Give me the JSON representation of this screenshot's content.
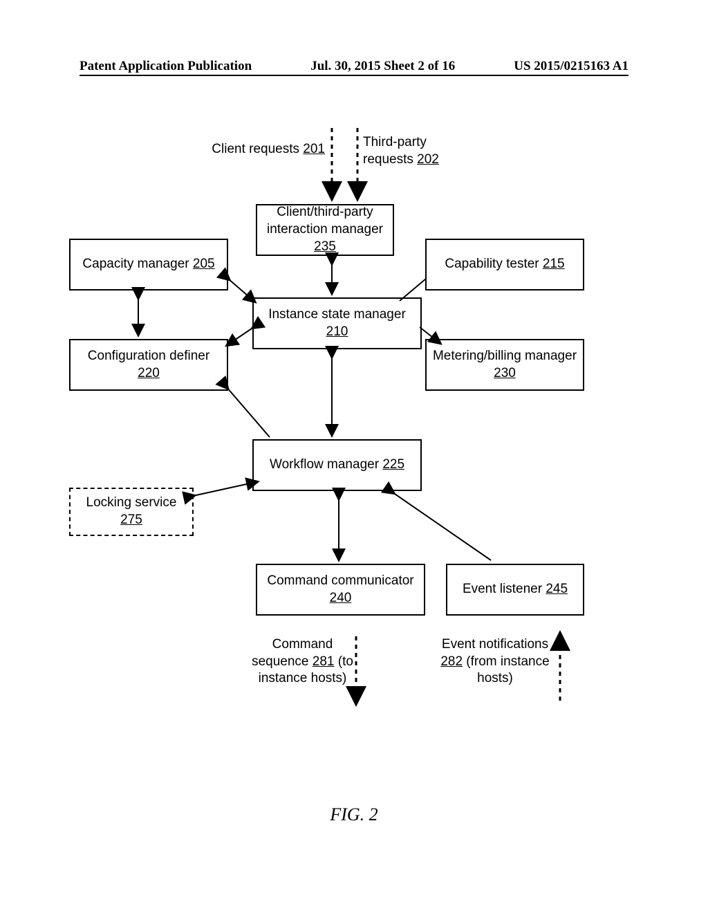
{
  "header": {
    "left": "Patent Application Publication",
    "center": "Jul. 30, 2015  Sheet 2 of 16",
    "right": "US 2015/0215163 A1"
  },
  "figure_label": "FIG. 2",
  "labels": {
    "client_requests": {
      "text": "Client requests ",
      "ref": "201"
    },
    "third_party_requests": {
      "text": "Third-party requests ",
      "ref": "202"
    },
    "command_sequence_a": "Command",
    "command_sequence_b": "sequence ",
    "command_sequence_ref": "281",
    "command_sequence_c": " (to instance hosts)",
    "event_notifications_a": "Event notifications ",
    "event_notifications_ref": "282",
    "event_notifications_b": " (from instance hosts)"
  },
  "boxes": {
    "interaction_manager": {
      "text": "Client/third-party interaction manager ",
      "ref": "235"
    },
    "capacity_manager": {
      "text": "Capacity manager ",
      "ref": "205"
    },
    "capability_tester": {
      "text": "Capability tester ",
      "ref": "215"
    },
    "instance_state_manager": {
      "text": "Instance state manager ",
      "ref": "210"
    },
    "configuration_definer": {
      "text": "Configuration definer ",
      "ref": "220"
    },
    "metering_billing": {
      "text": "Metering/billing manager ",
      "ref": "230"
    },
    "workflow_manager": {
      "text": "Workflow manager ",
      "ref": "225"
    },
    "locking_service": {
      "text": "Locking service ",
      "ref": "275"
    },
    "command_communicator": {
      "text": "Command communicator ",
      "ref": "240"
    },
    "event_listener": {
      "text": "Event listener ",
      "ref": "245"
    }
  }
}
